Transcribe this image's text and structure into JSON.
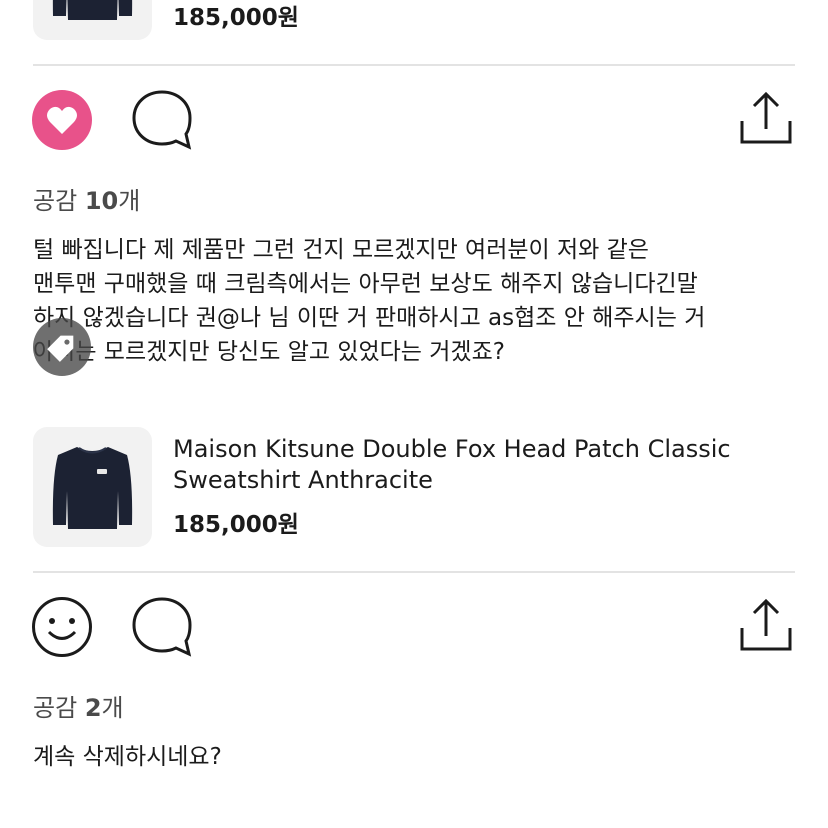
{
  "product_top": {
    "price": "185,000원"
  },
  "post1": {
    "empathy_label": "공감",
    "empathy_count": "10",
    "empathy_unit": "개",
    "comment_lines": [
      "털 빠집니다 제 제품만 그런 건지 모르겠지만 여러분이 저와 같은",
      "맨투맨 구매했을 때 크림측에서는 아무런 보상도 해주지 않습니다긴말",
      "하지 않겠습니다 권@나 님 이딴 거 판매하시고 as협조 안 해주시는 거",
      "아시는 모르겠지만 당신도 알고 있었다는 거겠죠?"
    ],
    "liked": true
  },
  "product_mid": {
    "name_line1": "Maison Kitsune Double Fox Head Patch Classic",
    "name_line2": "Sweatshirt Anthracite",
    "price": "185,000원"
  },
  "post2": {
    "empathy_label": "공감",
    "empathy_count": "2",
    "empathy_unit": "개",
    "comment": "계속 삭제하시네요?",
    "liked": false
  },
  "icons": {
    "like_active": "heart-filled-icon",
    "like_inactive": "smiley-icon",
    "comment": "speech-bubble-icon",
    "share": "share-icon",
    "tag": "price-tag-icon"
  },
  "colors": {
    "like_pink": "#e8528a",
    "text": "#1b1b1b",
    "muted": "#4a4a4a",
    "divider": "#e3e3e3",
    "thumb_bg": "#f2f2f2",
    "sweatshirt": "#1c2233"
  }
}
